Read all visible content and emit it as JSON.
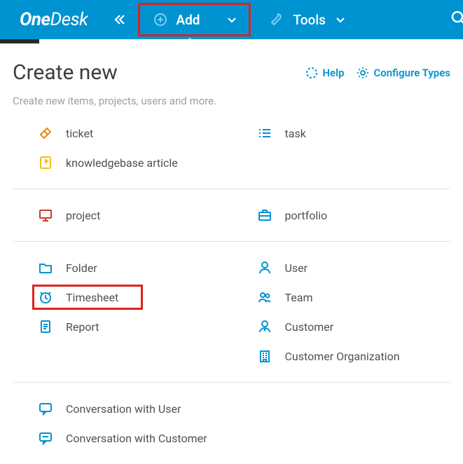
{
  "topbar": {
    "logo_part1": "One",
    "logo_part2": "Desk",
    "add_label": "Add",
    "tools_label": "Tools"
  },
  "page": {
    "title": "Create new",
    "subtitle": "Create new items, projects, users and more.",
    "help_label": "Help",
    "configure_label": "Configure Types"
  },
  "sections": [
    {
      "left": [
        {
          "name": "ticket",
          "label": "ticket"
        },
        {
          "name": "kb-article",
          "label": "knowledgebase article"
        }
      ],
      "right": [
        {
          "name": "task",
          "label": "task"
        }
      ]
    },
    {
      "left": [
        {
          "name": "project",
          "label": "project"
        }
      ],
      "right": [
        {
          "name": "portfolio",
          "label": "portfolio"
        }
      ]
    },
    {
      "left": [
        {
          "name": "folder",
          "label": "Folder"
        },
        {
          "name": "timesheet",
          "label": "Timesheet"
        },
        {
          "name": "report",
          "label": "Report"
        }
      ],
      "right": [
        {
          "name": "user",
          "label": "User"
        },
        {
          "name": "team",
          "label": "Team"
        },
        {
          "name": "customer",
          "label": "Customer"
        },
        {
          "name": "customer-org",
          "label": "Customer Organization"
        }
      ]
    },
    {
      "left": [
        {
          "name": "conv-user",
          "label": "Conversation with User"
        },
        {
          "name": "conv-customer",
          "label": "Conversation with Customer"
        }
      ],
      "right": []
    }
  ]
}
